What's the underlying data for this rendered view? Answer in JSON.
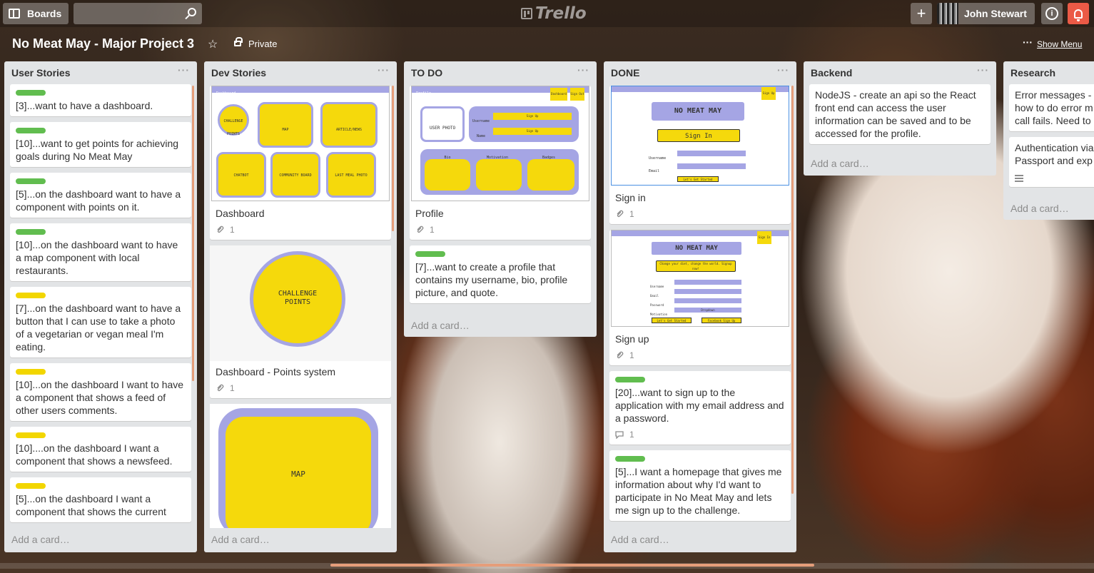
{
  "topbar": {
    "boards_label": "Boards",
    "search_placeholder": "",
    "logo_text": "Trello",
    "add_label": "+",
    "user_name": "John Stewart",
    "info_label": "i"
  },
  "board": {
    "title": "No Meat May - Major Project 3",
    "visibility": "Private",
    "menu_dots": "···",
    "show_menu": "Show Menu"
  },
  "lists": [
    {
      "title": "User Stories",
      "add_card": "Add a card…",
      "cards": [
        {
          "label": "green",
          "text": "[3]...want to have a dashboard."
        },
        {
          "label": "green",
          "text": "[10]...want to get points for achieving goals during No Meat May"
        },
        {
          "label": "green",
          "text": "[5]...on the dashboard want to have a component with points on it."
        },
        {
          "label": "green",
          "text": "[10]...on the dashboard want to have a map component with local restaurants."
        },
        {
          "label": "yellow",
          "text": "[7]...on the dashboard want to have a button that I can use to take a photo of a vegetarian or vegan meal I'm eating."
        },
        {
          "label": "yellow",
          "text": "[10]...on the dashboard I want to have a component that shows a feed of other users comments."
        },
        {
          "label": "yellow",
          "text": "[10]....on the dashboard I want a component that shows a newsfeed."
        },
        {
          "label": "yellow",
          "text": "[5]...on the dashboard I want a component that shows the current"
        }
      ]
    },
    {
      "title": "Dev Stories",
      "add_card": "Add a card…",
      "cards": [
        {
          "title": "Dashboard",
          "attachments": "1",
          "mock": {
            "bar": "Dashboard",
            "boxes": [
              "CHALLENGE POINTS",
              "MAP",
              "ARTICLE/NEWS",
              "CHATBOT",
              "COMMUNITY BOARD",
              "LAST MEAL PHOTO"
            ]
          }
        },
        {
          "title": "Dashboard - Points system",
          "attachments": "1",
          "mock": {
            "text": "CHALLENGE POINTS"
          }
        },
        {
          "title": "",
          "mock": {
            "text": "MAP"
          }
        }
      ]
    },
    {
      "title": "TO DO",
      "add_card": "Add a card…",
      "cards": [
        {
          "title": "Profile",
          "attachments": "1",
          "mock": {
            "bar": "Profile",
            "photo": "USER PHOTO",
            "fields": [
              "Username",
              "Name"
            ],
            "sections": [
              "Bio",
              "Motivation",
              "Badges"
            ],
            "field_value": "Sign Up",
            "nav": [
              "Dashboard",
              "Sign Out"
            ]
          }
        },
        {
          "label": "green",
          "text": "[7]...want to create a profile that contains my username, bio, profile picture, and quote."
        }
      ]
    },
    {
      "title": "DONE",
      "add_card": "Add a card…",
      "cards": [
        {
          "title": "Sign in",
          "attachments": "1",
          "mock": {
            "heading": "NO MEAT MAY",
            "button": "Sign In",
            "fields": [
              "Username",
              "Email"
            ],
            "cta": "Let's Get Started",
            "nav": "Sign Up"
          }
        },
        {
          "title": "Sign up",
          "attachments": "1",
          "mock": {
            "heading": "NO MEAT MAY",
            "tagline": "Change your diet, change the world. Signup now!",
            "fields": [
              "Username",
              "Email",
              "Password",
              "Motivation"
            ],
            "dropdown": "Dropdown",
            "cta": "Let's Get Started",
            "cta2": "Facebook Sign Up",
            "nav": "Sign In"
          }
        },
        {
          "label": "green",
          "text": "[20]...want to sign up to the application with my email address and a password.",
          "comments": "1"
        },
        {
          "label": "green",
          "text": "[5]...I want a homepage that gives me information about why I'd want to participate in No Meat May and lets me sign up to the challenge."
        }
      ]
    },
    {
      "title": "Backend",
      "add_card": "Add a card…",
      "cards": [
        {
          "text": "NodeJS - create an api so the React front end can access the user information can be saved and to be accessed for the profile."
        }
      ]
    },
    {
      "title": "Research",
      "add_card": "Add a card…",
      "cards": [
        {
          "text": "Error messages - how to do error m call fails. Need to"
        },
        {
          "text": "Authentication via Passport and exp",
          "has_description": true
        }
      ]
    }
  ],
  "colors": {
    "label_green": "#61bd4f",
    "label_yellow": "#f2d600",
    "mock_yellow": "#f5d90c",
    "mock_lavender": "#a5a5e4",
    "notification": "#eb5a46",
    "list_bg": "#e2e4e6",
    "scroll_accent": "#e59d7a"
  }
}
